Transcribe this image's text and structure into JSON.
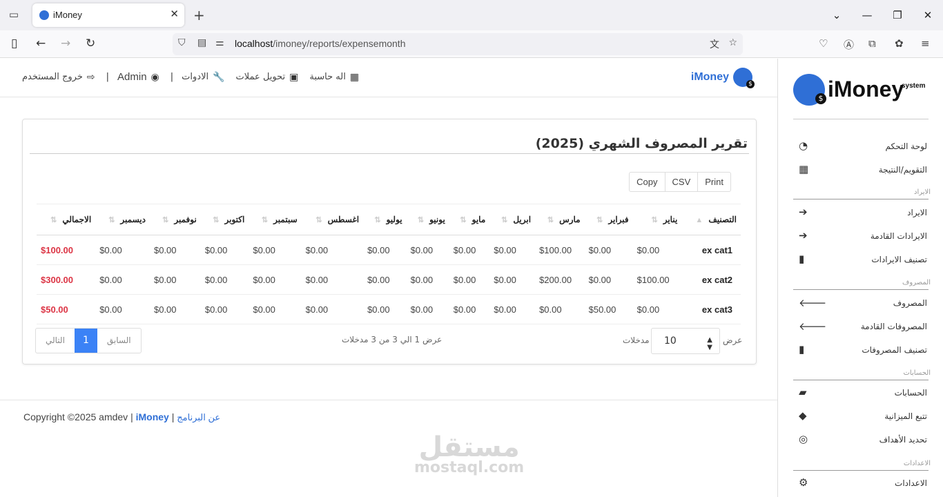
{
  "browser": {
    "tab_title": "iMoney",
    "url_host": "localhost",
    "url_path": "/imoney/reports/expensemonth"
  },
  "topnav": {
    "brand": "iMoney",
    "calculator": "اله حاسبة",
    "currency": "تحويل عملات",
    "tools": "الادوات",
    "user": "Admin",
    "logout": "خروج المستخدم",
    "separator": "|"
  },
  "report": {
    "title": "تقرير المصروف الشهري (2025)",
    "buttons": [
      "Copy",
      "CSV",
      "Print"
    ],
    "columns": [
      "التصنيف",
      "يناير",
      "فبراير",
      "مارس",
      "ابريل",
      "مايو",
      "يونيو",
      "يوليو",
      "اغسطس",
      "سبتمبر",
      "اكتوبر",
      "نوفمبر",
      "ديسمبر",
      "الاجمالي"
    ],
    "rows": [
      {
        "cat": "ex cat1",
        "months": [
          "$0.00",
          "$0.00",
          "$100.00",
          "$0.00",
          "$0.00",
          "$0.00",
          "$0.00",
          "$0.00",
          "$0.00",
          "$0.00",
          "$0.00",
          "$0.00"
        ],
        "total": "$100.00"
      },
      {
        "cat": "ex cat2",
        "months": [
          "$100.00",
          "$0.00",
          "$200.00",
          "$0.00",
          "$0.00",
          "$0.00",
          "$0.00",
          "$0.00",
          "$0.00",
          "$0.00",
          "$0.00",
          "$0.00"
        ],
        "total": "$300.00"
      },
      {
        "cat": "ex cat3",
        "months": [
          "$0.00",
          "$50.00",
          "$0.00",
          "$0.00",
          "$0.00",
          "$0.00",
          "$0.00",
          "$0.00",
          "$0.00",
          "$0.00",
          "$0.00",
          "$0.00"
        ],
        "total": "$50.00"
      }
    ],
    "length_show": "عرض",
    "length_value": "10",
    "length_entries": "مدخلات",
    "info": "عرض 1 الي 3 من 3 مدخلات",
    "pager_prev": "السابق",
    "pager_page": "1",
    "pager_next": "التالي"
  },
  "footer": {
    "copyright": "Copyright ©2025 amdev | ",
    "brand": "iMoney",
    "sep": " | ",
    "about": "عن البرنامج"
  },
  "watermark": {
    "ar": "مستقل",
    "en": "mostaql.com"
  },
  "sidebar": {
    "logo_text": "iMoney",
    "logo_sub": "system",
    "items_main": [
      {
        "label": "لوحة التحكم",
        "icon": "dashboard-icon"
      },
      {
        "label": "التقويم/النتيجة",
        "icon": "calendar-icon"
      }
    ],
    "section_income": "الايراد",
    "items_income": [
      {
        "label": "الايراد",
        "icon": "arrow-right-icon"
      },
      {
        "label": "الايرادات القادمة",
        "icon": "arrow-right-icon"
      },
      {
        "label": "تصنيف الايرادات",
        "icon": "bookmark-icon"
      }
    ],
    "section_expense": "المصروف",
    "items_expense": [
      {
        "label": "المصروف",
        "icon": "arrow-left-icon"
      },
      {
        "label": "المصروفات القادمة",
        "icon": "arrow-left-icon"
      },
      {
        "label": "تصنيف المصروفات",
        "icon": "bookmark-icon"
      }
    ],
    "section_accounts": "الحسابات",
    "items_accounts": [
      {
        "label": "الحسابات",
        "icon": "folder-icon"
      },
      {
        "label": "تتبع الميزانية",
        "icon": "tags-icon"
      },
      {
        "label": "تحديد الأهداف",
        "icon": "lifebuoy-icon"
      }
    ],
    "section_settings": "الاعدادات",
    "items_settings": [
      {
        "label": "الاعدادات",
        "icon": "gear-icon"
      }
    ]
  }
}
